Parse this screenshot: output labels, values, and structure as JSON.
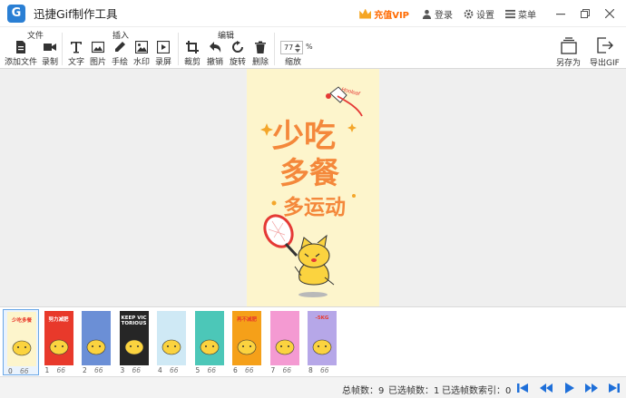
{
  "app": {
    "title": "迅捷Gif制作工具"
  },
  "titlebar": {
    "vip": "充值VIP",
    "login": "登录",
    "settings": "设置",
    "menu": "菜单"
  },
  "toolbar": {
    "groups": [
      "文件",
      "插入",
      "编辑"
    ],
    "file": [
      "添加文件",
      "录制"
    ],
    "insert": [
      "文字",
      "图片",
      "手绘",
      "水印",
      "录屏"
    ],
    "edit": [
      "裁剪",
      "撤销",
      "旋转",
      "删除"
    ],
    "zoom": {
      "value": "77",
      "unit": "%",
      "label": "缩放"
    },
    "save_as": "另存为",
    "export_gif": "导出GIF"
  },
  "preview": {
    "line1": "少吃",
    "line2": "多餐",
    "line3": "多运动",
    "bubble": "Hooleaf"
  },
  "frames": [
    {
      "index": "0",
      "ms": "66 ms",
      "bg": "#fdf5cc",
      "text": "少吃多餐"
    },
    {
      "index": "1",
      "ms": "66 ms",
      "bg": "#e8392b",
      "text": "努力减肥"
    },
    {
      "index": "2",
      "ms": "66 ms",
      "bg": "#6b8fd6",
      "text": ""
    },
    {
      "index": "3",
      "ms": "66 ms",
      "bg": "#262626",
      "text": "KEEP VICTORIOUS"
    },
    {
      "index": "4",
      "ms": "66 ms",
      "bg": "#cfe9f5",
      "text": ""
    },
    {
      "index": "5",
      "ms": "66 ms",
      "bg": "#4cc7b8",
      "text": ""
    },
    {
      "index": "6",
      "ms": "66 ms",
      "bg": "#f5a019",
      "text": "再不减肥"
    },
    {
      "index": "7",
      "ms": "66 ms",
      "bg": "#f49ad2",
      "text": ""
    },
    {
      "index": "8",
      "ms": "66 ms",
      "bg": "#b6a7e8",
      "text": "-5KG"
    }
  ],
  "status": {
    "total": "总帧数：9",
    "selected": "已选帧数：1",
    "selected_index": "已选帧数索引：0"
  },
  "colors": {
    "accent": "#2a7fd4",
    "vip": "#ff6a00",
    "player": "#1e6fd9"
  }
}
